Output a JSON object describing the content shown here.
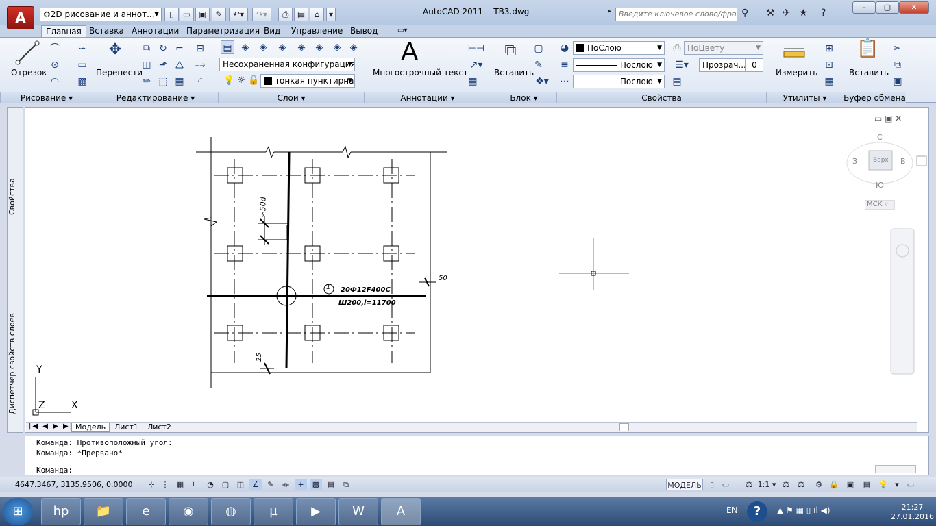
{
  "titlebar": {
    "app_letter": "A",
    "workspace": "2D рисование и аннот...",
    "app_name": "AutoCAD 2011",
    "file_name": "ТВ3.dwg",
    "search_placeholder": "Введите ключевое слово/фразу",
    "min_label": "–",
    "max_label": "▢",
    "close_label": "✕"
  },
  "tabs": [
    "Главная",
    "Вставка",
    "Аннотации",
    "Параметризация",
    "Вид",
    "Управление",
    "Вывод"
  ],
  "ribbon": {
    "draw": {
      "line": "Отрезок",
      "panel": "Рисование ▾"
    },
    "modify": {
      "move": "Перенести",
      "panel": "Редактирование ▾"
    },
    "layers": {
      "state": "Несохраненная конфигурация сл",
      "current": "тонкая пунктирна",
      "panel": "Слои ▾"
    },
    "annotation": {
      "mtext": "Многострочный текст",
      "glyph": "A",
      "panel": "Аннотации ▾"
    },
    "block": {
      "insert": "Вставить",
      "panel": "Блок ▾"
    },
    "properties": {
      "color": "ПоСлою",
      "linetype": "Послою",
      "lineweight": "Послою",
      "plotstyle": "ПоЦвету",
      "transparency_label": "Прозрач...",
      "transparency_value": "0",
      "panel": "Свойства"
    },
    "utilities": {
      "measure": "Измерить",
      "panel": "Утилиты ▾"
    },
    "clipboard": {
      "paste": "Вставить",
      "panel": "Буфер обмена"
    }
  },
  "palettes": {
    "properties": "Свойства",
    "layer_manager": "Диспетчер свойств слоев"
  },
  "viewcube": {
    "north": "С",
    "south": "Ю",
    "west": "З",
    "east": "В",
    "face": "Верх",
    "ucs": "МСК ▿"
  },
  "drawing": {
    "callout_number": "1",
    "rebar_spec": "20Ф12F400C",
    "rebar_spacing": "Ш200,l=11700",
    "dim_50d": "≈50d",
    "dim_50": "50",
    "dim_25": "25"
  },
  "ucs_icon": {
    "y": "Y",
    "x": "X",
    "z": "Z"
  },
  "layout_tabs": [
    "Модель",
    "Лист1",
    "Лист2"
  ],
  "command_line": {
    "lines": [
      "Команда: Противоположный угол:",
      "Команда: *Прервано*"
    ],
    "prompt": "Команда:"
  },
  "status": {
    "coordinates": "4647.3467, 3135.9506, 0.0000",
    "space": "МОДЕЛЬ",
    "scale": "1:1 ▾"
  },
  "taskbar": {
    "lang": "EN",
    "time": "21:27",
    "date": "27.01.2016",
    "apps": [
      "hp-icon",
      "explorer-icon",
      "ie-icon",
      "media-icon",
      "chrome-icon",
      "utorrent-icon",
      "kmplayer-icon",
      "word-icon",
      "autocad-icon"
    ]
  },
  "colors": {
    "ribbon_bg": "#dde6f3",
    "title_bg": "#c8d6ea",
    "taskbar": "#2c4a74",
    "crosshair_x": "#e04040",
    "crosshair_y": "#30b030"
  }
}
